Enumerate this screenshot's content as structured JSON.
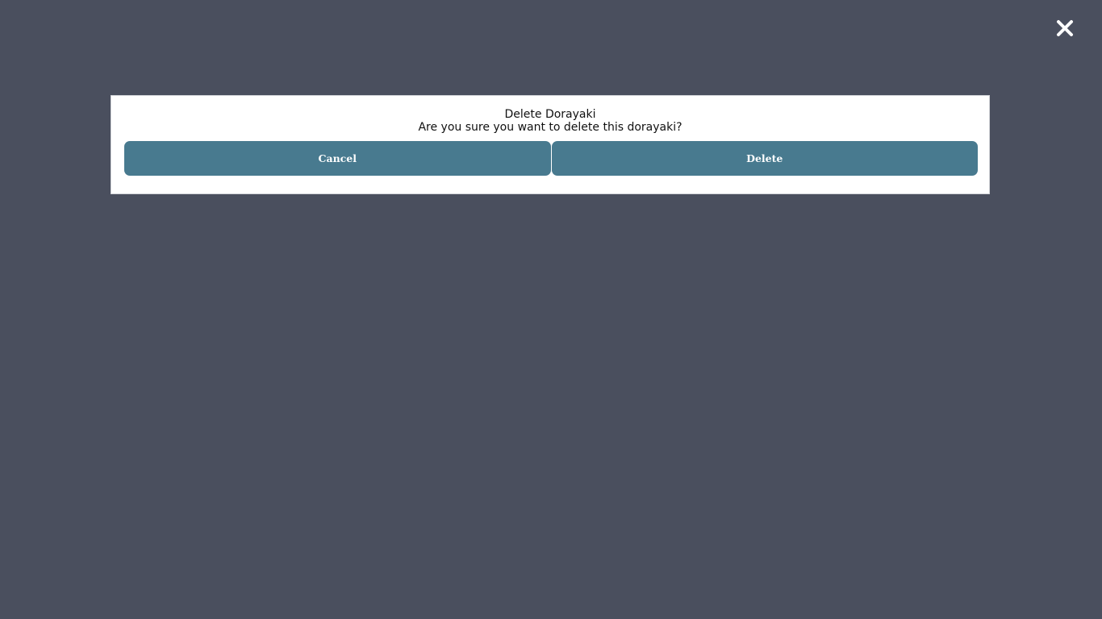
{
  "close_button": {
    "icon": "close-icon",
    "color": "#ffffff"
  },
  "dialog": {
    "title": "Delete Dorayaki",
    "message": "Are you sure you want to delete this dorayaki?",
    "cancel_label": "Cancel",
    "delete_label": "Delete"
  },
  "colors": {
    "backdrop": "#4a4f5e",
    "button": "#487a8f",
    "button_text": "#ffffff",
    "dialog_background": "#ffffff"
  }
}
